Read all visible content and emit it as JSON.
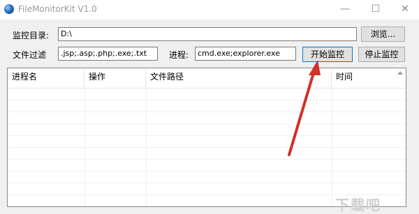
{
  "window": {
    "title": "FileMonitorKit V1.0",
    "minimize": "—",
    "maximize": "☐",
    "close": "✕"
  },
  "form": {
    "dir_label": "监控目录:",
    "dir_value": "D:\\",
    "browse": "浏览...",
    "filter_label": "文件过滤",
    "filter_value": ".jsp;.asp;.php;.exe;.txt",
    "process_label": "进程:",
    "process_value": "cmd.exe;explorer.exe",
    "start": "开始监控",
    "stop": "停止监控"
  },
  "table": {
    "columns": [
      "进程名",
      "操作",
      "文件路径",
      "时间"
    ]
  },
  "annotation": {
    "arrow_color": "#d2302a"
  },
  "watermark": "下载吧"
}
